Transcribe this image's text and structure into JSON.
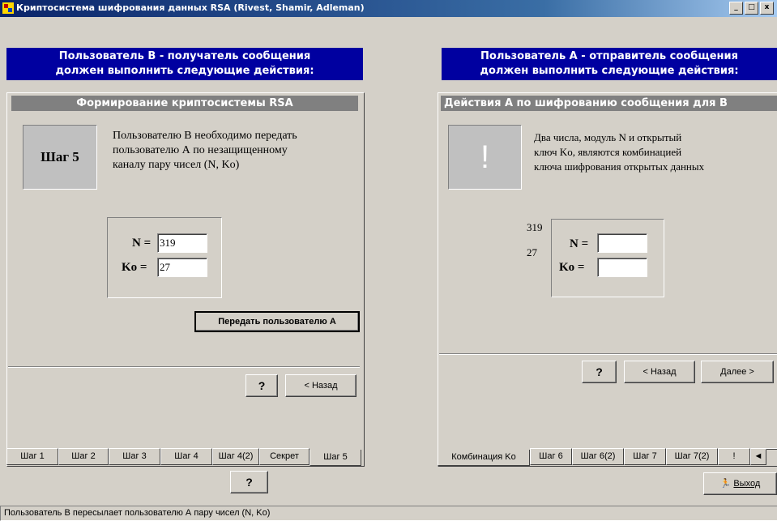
{
  "window": {
    "title": "Криптосистема шифрования данных RSA (Rivest, Shamir, Adleman)"
  },
  "left": {
    "header_line1": "Пользователь В - получатель сообщения",
    "header_line2": "должен выполнить следующие действия:",
    "subheader": "Формирование криптосистемы RSA",
    "step_label": "Шаг 5",
    "desc_line1": "Пользователю В необходимо передать",
    "desc_line2": "пользователю А по незащищенному",
    "desc_line3": "каналу пару чисел (N, Ko)",
    "n_label": "N =",
    "n_value": "319",
    "ko_label": "Ko =",
    "ko_value": "27",
    "send_button": "Передать пользователю А",
    "help_button": "?",
    "back_button": "< Назад",
    "tabs": [
      "Шаг 1",
      "Шаг 2",
      "Шаг 3",
      "Шаг 4",
      "Шаг 4(2)",
      "Секрет",
      "Шаг 5"
    ],
    "bottom_help": "?"
  },
  "right": {
    "header_line1": "Пользователь А - отправитель сообщения",
    "header_line2": "должен выполнить следующие действия:",
    "subheader": "Действия А по шифрованию сообщения для В",
    "step_label": "!",
    "desc_line1": "Два числа, модуль N и открытый",
    "desc_line2": "ключ Ko, являются комбинацией",
    "desc_line3": "ключа шифрования открытых данных",
    "received_n": "319",
    "received_ko": "27",
    "n_label": "N =",
    "n_value": "",
    "ko_label": "Ko =",
    "ko_value": "",
    "help_button": "?",
    "back_button": "< Назад",
    "next_button": "Далее >",
    "tabs": [
      "Комбинация Ko",
      "Шаг 6",
      "Шаг 6(2)",
      "Шаг 7",
      "Шаг 7(2)",
      "!"
    ],
    "exit_button": "Выход"
  },
  "status": {
    "text": "Пользователь В пересылает пользователю А пару чисел (N, Ko)"
  }
}
